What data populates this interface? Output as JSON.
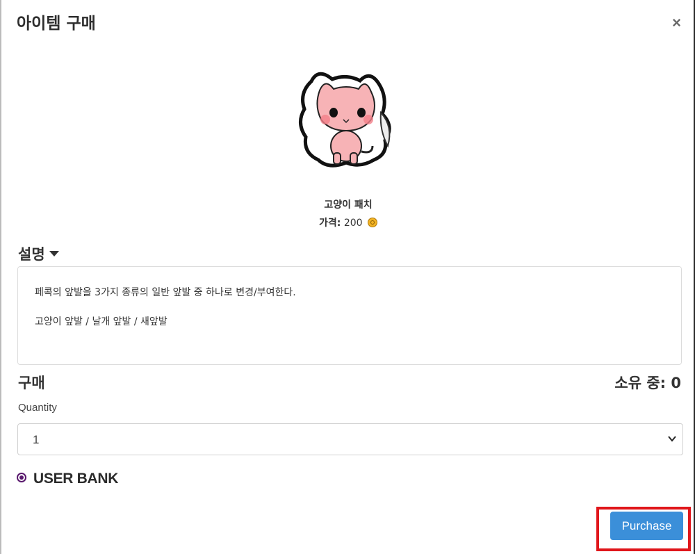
{
  "modal": {
    "title": "아이템 구매",
    "close_label": "×"
  },
  "item": {
    "name": "고양이 패치",
    "price_label": "가격:",
    "price_value": "200",
    "image_icon": "cat-sticker-image",
    "currency_icon": "coin-icon"
  },
  "description": {
    "heading": "설명",
    "line1": "페콕의 앞발을 3가지 종류의 일반 앞발 중 하나로 변경/부여한다.",
    "line2": "고양이 앞발 / 날개 앞발 / 새앞발"
  },
  "purchase": {
    "heading": "구매",
    "owned_label": "소유 중: 0",
    "quantity_label": "Quantity",
    "quantity_value": "1",
    "bank_option": "USER BANK",
    "button_label": "Purchase"
  },
  "colors": {
    "accent": "#3b8fd9",
    "highlight": "#e0161b",
    "radio": "#5a1a6e"
  }
}
